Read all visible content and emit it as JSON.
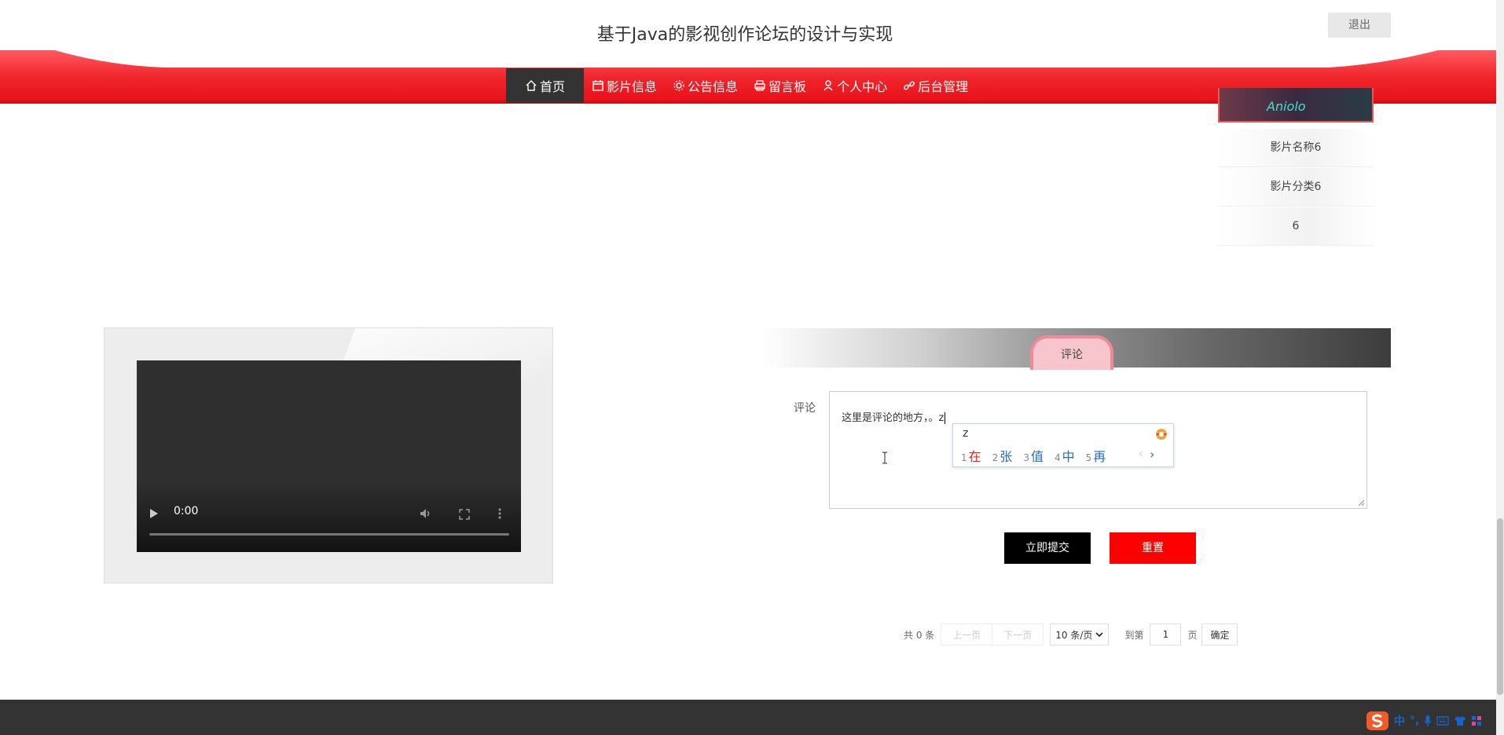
{
  "header": {
    "title": "基于Java的影视创作论坛的设计与实现",
    "logout_label": "退出"
  },
  "nav": {
    "items": [
      {
        "label": "首页",
        "icon": "home-icon",
        "active": true
      },
      {
        "label": "影片信息",
        "icon": "calendar-icon"
      },
      {
        "label": "公告信息",
        "icon": "gear-icon"
      },
      {
        "label": "留言板",
        "icon": "printer-icon"
      },
      {
        "label": "个人中心",
        "icon": "user-icon"
      },
      {
        "label": "后台管理",
        "icon": "link-icon"
      }
    ]
  },
  "sidebar": {
    "thumb_text": "Aniolo",
    "rows": [
      "影片名称6",
      "影片分类6",
      "6"
    ]
  },
  "video": {
    "time": "0:00"
  },
  "comment": {
    "section_title": "评论",
    "field_label": "评论",
    "value": "这里是评论的地方，。z"
  },
  "ime": {
    "input": "z",
    "candidates": [
      {
        "num": "1",
        "text": "在"
      },
      {
        "num": "2",
        "text": "张"
      },
      {
        "num": "3",
        "text": "值"
      },
      {
        "num": "4",
        "text": "中"
      },
      {
        "num": "5",
        "text": "再"
      }
    ],
    "prev": "‹",
    "next": "›"
  },
  "actions": {
    "submit_label": "立即提交",
    "reset_label": "重置"
  },
  "pagination": {
    "total": "共 0 条",
    "prev": "上一页",
    "next": "下一页",
    "page_size": "10 条/页",
    "goto_label": "到第",
    "page_value": "1",
    "page_suffix": "页",
    "confirm": "确定"
  },
  "tray": {
    "lang": "中",
    "punct": "°,"
  },
  "colors": {
    "nav_red": "#f0262d",
    "submit_bg": "#000000",
    "reset_bg": "#ff0000",
    "footer_bg": "#333333"
  }
}
